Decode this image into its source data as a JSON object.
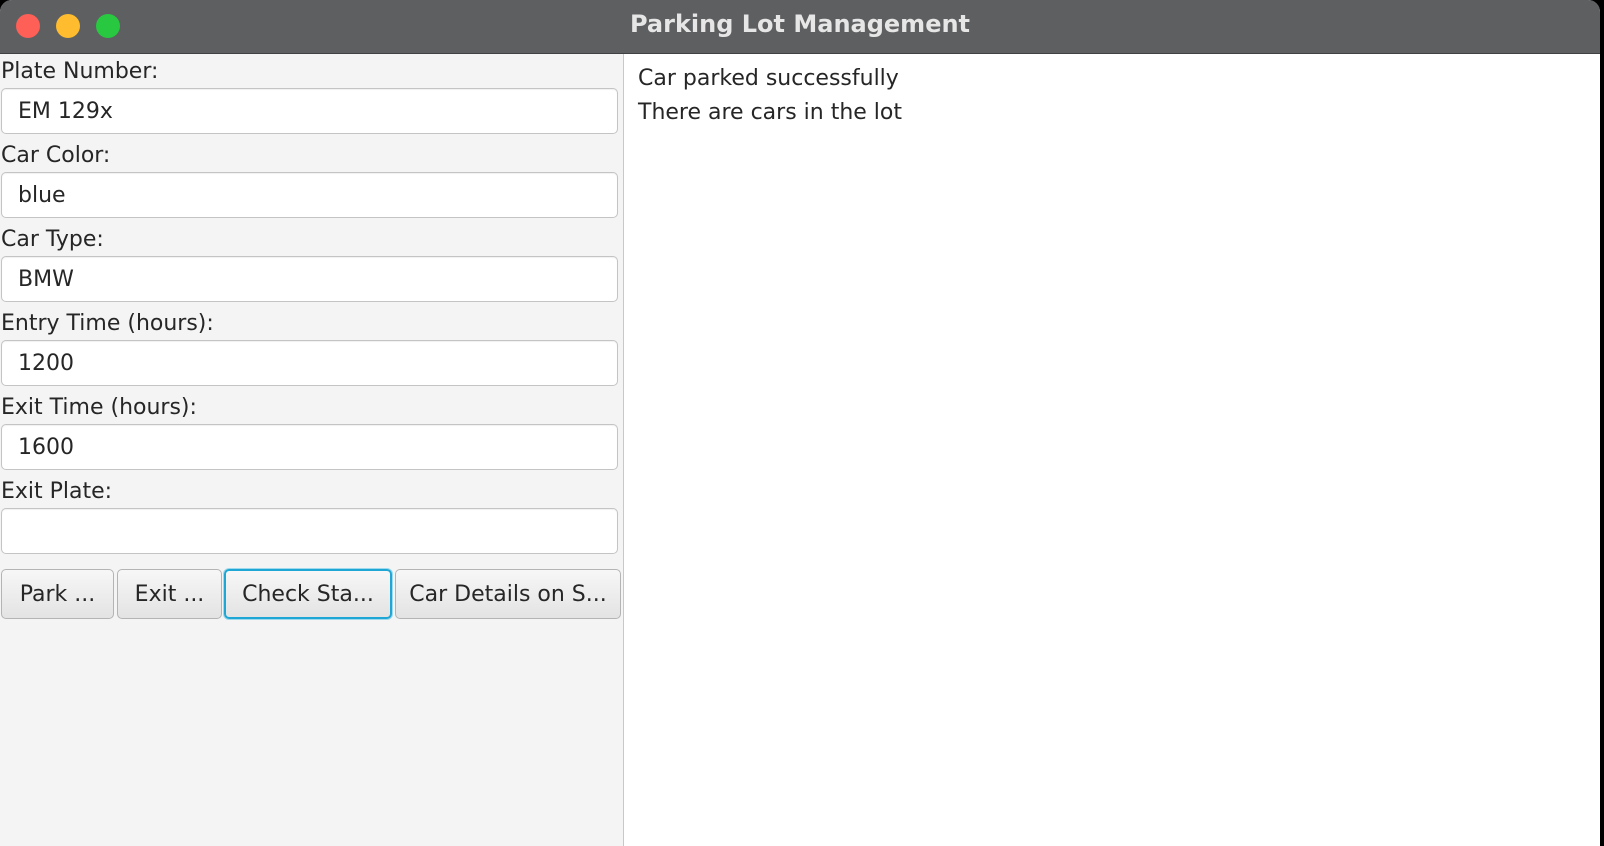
{
  "window": {
    "title": "Parking Lot Management"
  },
  "form": {
    "plate_number": {
      "label": "Plate Number:",
      "value": "EM 129x"
    },
    "car_color": {
      "label": "Car Color:",
      "value": "blue"
    },
    "car_type": {
      "label": "Car Type:",
      "value": "BMW"
    },
    "entry_time": {
      "label": "Entry Time (hours):",
      "value": "1200"
    },
    "exit_time": {
      "label": "Exit Time (hours):",
      "value": "1600"
    },
    "exit_plate": {
      "label": "Exit Plate:",
      "value": ""
    }
  },
  "buttons": {
    "park": "Park ...",
    "exit": "Exit ...",
    "check_status": "Check Sta...",
    "car_details": "Car Details on S..."
  },
  "output": {
    "lines": [
      "Car parked successfully",
      "There are cars in the lot"
    ]
  },
  "colors": {
    "close": "#fe5f57",
    "minimize": "#febc2e",
    "maximize": "#28c840",
    "focus_ring": "#1ea7d4"
  }
}
